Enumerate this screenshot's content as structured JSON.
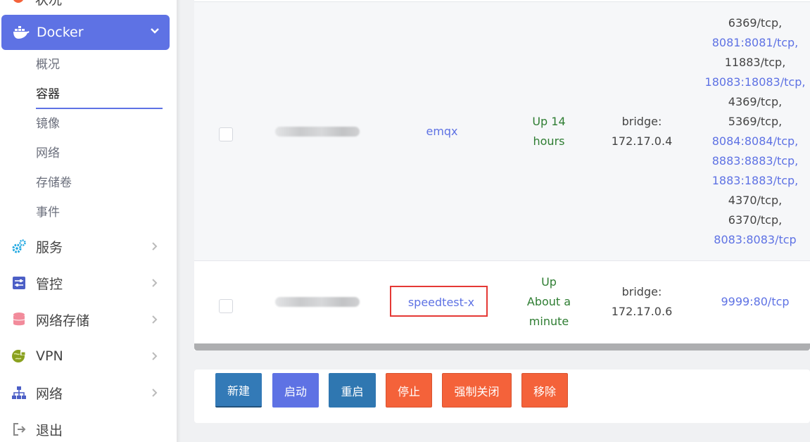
{
  "sidebar": {
    "partial_top_label": "状况",
    "docker_label": "Docker",
    "docker_sub": [
      {
        "label": "概况"
      },
      {
        "label": "容器"
      },
      {
        "label": "镜像"
      },
      {
        "label": "网络"
      },
      {
        "label": "存储卷"
      },
      {
        "label": "事件"
      }
    ],
    "items": [
      {
        "label": "服务",
        "icon": "gears-icon"
      },
      {
        "label": "管控",
        "icon": "sliders-icon"
      },
      {
        "label": "网络存储",
        "icon": "database-icon"
      },
      {
        "label": "VPN",
        "icon": "globe-lock-icon"
      },
      {
        "label": "网络",
        "icon": "network-icon"
      },
      {
        "label": "退出",
        "icon": "logout-icon"
      }
    ],
    "accent_color": "#5e72e4"
  },
  "containers": [
    {
      "name": "emqx",
      "status": [
        "Up 14",
        "hours"
      ],
      "network": [
        "bridge:",
        "172.17.0.4"
      ],
      "ports": [
        {
          "text": "6369/tcp,",
          "link": false
        },
        {
          "text": "8081:8081/tcp,",
          "link": true
        },
        {
          "text": "11883/tcp,",
          "link": false
        },
        {
          "text": "18083:18083/tcp,",
          "link": true
        },
        {
          "text": "4369/tcp,",
          "link": false
        },
        {
          "text": "5369/tcp,",
          "link": false
        },
        {
          "text": "8084:8084/tcp,",
          "link": true
        },
        {
          "text": "8883:8883/tcp,",
          "link": true
        },
        {
          "text": "1883:1883/tcp,",
          "link": true
        },
        {
          "text": "4370/tcp,",
          "link": false
        },
        {
          "text": "6370/tcp,",
          "link": false
        },
        {
          "text": "8083:8083/tcp",
          "link": true
        }
      ]
    },
    {
      "name": "speedtest-x",
      "status": [
        "Up",
        "About a",
        "minute"
      ],
      "network": [
        "bridge:",
        "172.17.0.6"
      ],
      "ports": [
        {
          "text": "9999:80/tcp",
          "link": true
        }
      ]
    }
  ],
  "actions": {
    "new": "新建",
    "start": "启动",
    "restart": "重启",
    "stop": "停止",
    "kill": "强制关闭",
    "remove": "移除"
  }
}
